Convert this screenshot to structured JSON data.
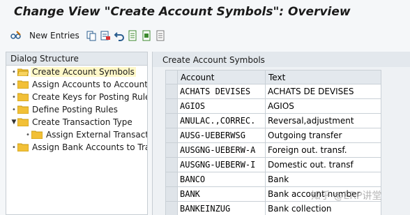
{
  "window": {
    "title": "Change View \"Create Account Symbols\": Overview"
  },
  "toolbar": {
    "new_entries_label": "New Entries",
    "icons": [
      "glasses-pencil-icon",
      "copy-icon",
      "delete-icon",
      "undo-icon",
      "select-all-icon",
      "select-block-icon",
      "deselect-icon"
    ]
  },
  "dialog_structure": {
    "header": "Dialog Structure",
    "items": [
      {
        "label": "Create Account Symbols",
        "selected": true
      },
      {
        "label": "Assign Accounts to Account"
      },
      {
        "label": "Create Keys for Posting Rules"
      },
      {
        "label": "Define Posting Rules"
      },
      {
        "label": "Create Transaction Type",
        "expanded": true
      },
      {
        "label": "Assign External Transactio"
      },
      {
        "label": "Assign Bank Accounts to Tra"
      }
    ]
  },
  "table": {
    "title": "Create Account Symbols",
    "columns": [
      "Account",
      "Text"
    ],
    "rows": [
      {
        "account": "ACHATS DEVISES",
        "text": "ACHATS DE DEVISES"
      },
      {
        "account": "AGIOS",
        "text": "AGIOS"
      },
      {
        "account": "ANULAC.,CORREC.",
        "text": "Reversal,adjustment"
      },
      {
        "account": "AUSG-UEBERWSG",
        "text": "Outgoing transfer"
      },
      {
        "account": "AUSGNG-UEBERW-A",
        "text": "Foreign out. transf."
      },
      {
        "account": "AUSGNG-UEBERW-I",
        "text": "Domestic out. transf"
      },
      {
        "account": "BANCO",
        "text": "Bank"
      },
      {
        "account": "BANK",
        "text": "Bank account number"
      },
      {
        "account": "BANKEINZUG",
        "text": "Bank collection"
      }
    ]
  },
  "watermark": "知乎 @ERP讲堂",
  "colors": {
    "folder": "#f2c037",
    "folder_edge": "#c79a12",
    "selected": "#fff8c8"
  }
}
